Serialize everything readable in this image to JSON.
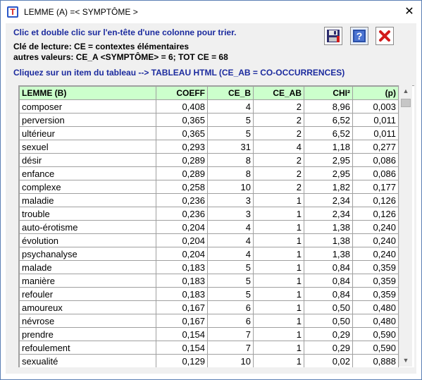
{
  "window": {
    "title": "LEMME (A) =< SYMPTÔME >",
    "close_glyph": "✕"
  },
  "info": {
    "sort_hint": "Clic et double clic sur l'en-tête d'une colonne pour trier.",
    "legend": "Clé de lecture: CE = contextes élémentaires",
    "other_values": "autres valeurs: CE_A <SYMPTÔME> = 6; TOT CE = 68",
    "click_hint": "Cliquez sur un item du tableau --> TABLEAU  HTML (CE_AB = CO-OCCURRENCES)"
  },
  "toolbar": {
    "save_icon": "floppy-disk-icon",
    "help_icon": "help-icon",
    "close_icon": "red-x-icon",
    "accent_blue": "#1c2b9e",
    "close_red": "#d21b1b"
  },
  "table": {
    "columns": [
      "LEMME (B)",
      "COEFF",
      "CE_B",
      "CE_AB",
      "CHI²",
      "(p)"
    ],
    "header_bg": "#ccffcc",
    "rows": [
      [
        "composer",
        "0,408",
        "4",
        "2",
        "8,96",
        "0,003"
      ],
      [
        "perversion",
        "0,365",
        "5",
        "2",
        "6,52",
        "0,011"
      ],
      [
        "ultérieur",
        "0,365",
        "5",
        "2",
        "6,52",
        "0,011"
      ],
      [
        "sexuel",
        "0,293",
        "31",
        "4",
        "1,18",
        "0,277"
      ],
      [
        "désir",
        "0,289",
        "8",
        "2",
        "2,95",
        "0,086"
      ],
      [
        "enfance",
        "0,289",
        "8",
        "2",
        "2,95",
        "0,086"
      ],
      [
        "complexe",
        "0,258",
        "10",
        "2",
        "1,82",
        "0,177"
      ],
      [
        "maladie",
        "0,236",
        "3",
        "1",
        "2,34",
        "0,126"
      ],
      [
        "trouble",
        "0,236",
        "3",
        "1",
        "2,34",
        "0,126"
      ],
      [
        "auto-érotisme",
        "0,204",
        "4",
        "1",
        "1,38",
        "0,240"
      ],
      [
        "évolution",
        "0,204",
        "4",
        "1",
        "1,38",
        "0,240"
      ],
      [
        "psychanalyse",
        "0,204",
        "4",
        "1",
        "1,38",
        "0,240"
      ],
      [
        "malade",
        "0,183",
        "5",
        "1",
        "0,84",
        "0,359"
      ],
      [
        "manière",
        "0,183",
        "5",
        "1",
        "0,84",
        "0,359"
      ],
      [
        "refouler",
        "0,183",
        "5",
        "1",
        "0,84",
        "0,359"
      ],
      [
        "amoureux",
        "0,167",
        "6",
        "1",
        "0,50",
        "0,480"
      ],
      [
        "névrose",
        "0,167",
        "6",
        "1",
        "0,50",
        "0,480"
      ],
      [
        "prendre",
        "0,154",
        "7",
        "1",
        "0,29",
        "0,590"
      ],
      [
        "refoulement",
        "0,154",
        "7",
        "1",
        "0,29",
        "0,590"
      ],
      [
        "sexualité",
        "0,129",
        "10",
        "1",
        "0,02",
        "0,888"
      ]
    ]
  },
  "scrollbar": {
    "up_glyph": "▲",
    "down_glyph": "▼"
  }
}
